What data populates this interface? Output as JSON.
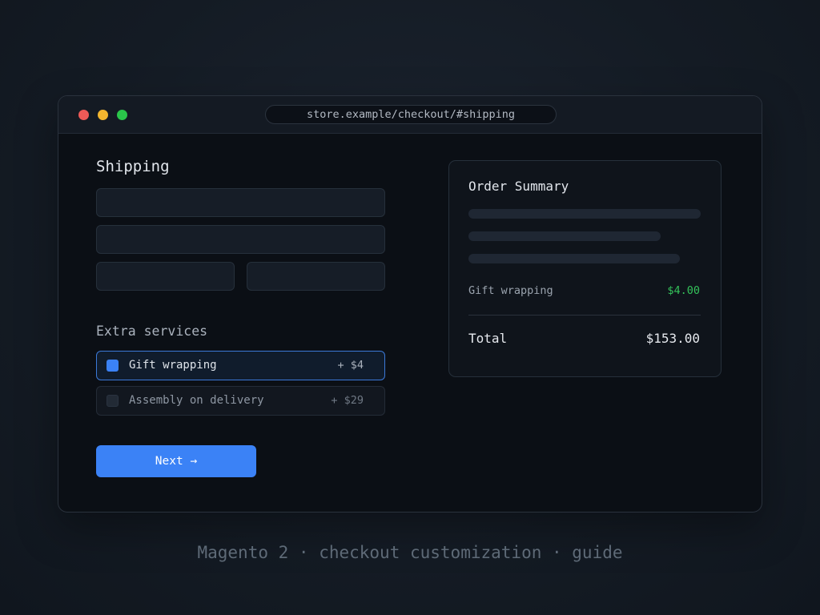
{
  "browser": {
    "url": "store.example/checkout/#shipping"
  },
  "shipping": {
    "heading": "Shipping"
  },
  "extra_services": {
    "heading": "Extra services",
    "items": [
      {
        "label": "Gift wrapping",
        "price": "+ $4",
        "checked": true
      },
      {
        "label": "Assembly on delivery",
        "price": "+ $29",
        "checked": false
      }
    ]
  },
  "actions": {
    "next_label": "Next →"
  },
  "summary": {
    "title": "Order Summary",
    "line_item": {
      "label": "Gift wrapping",
      "amount": "$4.00"
    },
    "total_label": "Total",
    "total_amount": "$153.00"
  },
  "caption": "Magento 2 · checkout customization · guide",
  "colors": {
    "accent": "#3b82f6",
    "positive": "#34c25a",
    "window_close": "#ef5a57",
    "window_minimize": "#f3b62f",
    "window_zoom": "#2ac64a"
  }
}
